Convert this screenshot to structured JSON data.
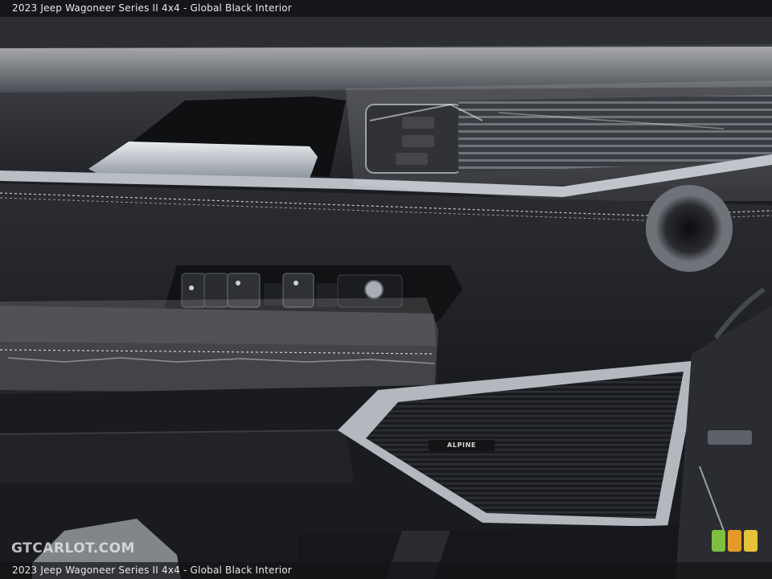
{
  "caption": {
    "top": "2023 Jeep Wagoneer Series II 4x4 - Global Black Interior",
    "bottom": "2023 Jeep Wagoneer Series II 4x4 - Global Black Interior"
  },
  "watermark": "GTCARLOT.COM",
  "speaker_brand": "ALPINE",
  "colors": {
    "leather": "#2a2b2f",
    "panel_dark": "#1d1e22",
    "trim_silver": "#b9bec4",
    "stitching": "#c9c9c9",
    "badge_green": "#7fbf3f",
    "badge_orange": "#e39a2a",
    "badge_yellow": "#e6c23a"
  },
  "icons": [
    "window-switch-icon",
    "mirror-knob-icon",
    "memory-seat-icon",
    "cup-holder-icon"
  ]
}
